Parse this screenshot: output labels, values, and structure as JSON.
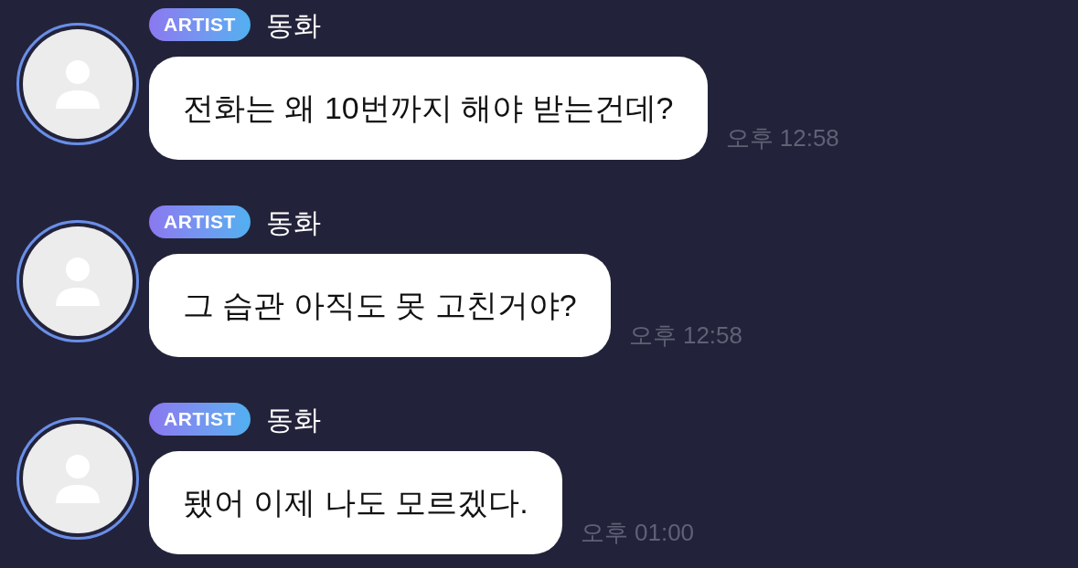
{
  "messages": [
    {
      "badge": "ARTIST",
      "name": "동화",
      "text": "전화는 왜 10번까지 해야 받는건데?",
      "time": "오후 12:58"
    },
    {
      "badge": "ARTIST",
      "name": "동화",
      "text": "그 습관 아직도 못 고친거야?",
      "time": "오후 12:58"
    },
    {
      "badge": "ARTIST",
      "name": "동화",
      "text": "됐어 이제 나도 모르겠다.",
      "time": "오후 01:00"
    }
  ]
}
